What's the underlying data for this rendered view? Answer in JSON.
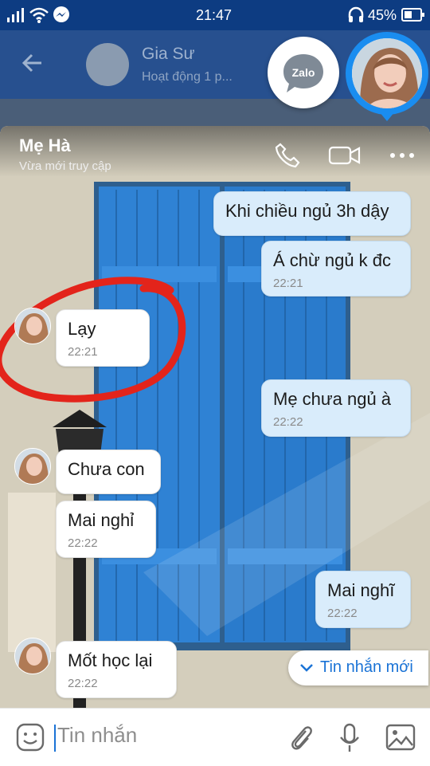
{
  "status_bar": {
    "time": "21:47",
    "battery_pct": "45%"
  },
  "background_chat": {
    "name": "Gia Sư",
    "status": "Hoạt động 1 p..."
  },
  "floating": {
    "app_label": "Zalo"
  },
  "chat": {
    "contact_name": "Mẹ Hà",
    "contact_status": "Vừa mới truy cập",
    "messages": [
      {
        "dir": "out",
        "text": "Khi chiều ngủ 3h dậy"
      },
      {
        "dir": "out",
        "text": "Á chừ ngủ k đc",
        "time": "22:21"
      },
      {
        "dir": "in",
        "text": "Lạy",
        "time": "22:21"
      },
      {
        "dir": "out",
        "text": "Mẹ chưa ngủ à",
        "time": "22:22"
      },
      {
        "dir": "in",
        "text": "Chưa con"
      },
      {
        "dir": "in",
        "text": "Mai nghỉ",
        "time": "22:22"
      },
      {
        "dir": "out",
        "text": "Mai nghĩ",
        "time": "22:22"
      },
      {
        "dir": "in",
        "text": "Mốt học lại",
        "time": "22:22"
      }
    ],
    "new_messages_label": "Tin nhắn mới"
  },
  "composer": {
    "placeholder": "Tin nhắn"
  },
  "colors": {
    "header_blue": "#0d3c82",
    "accent": "#1a8df0",
    "annotation_red": "#e3241b"
  }
}
